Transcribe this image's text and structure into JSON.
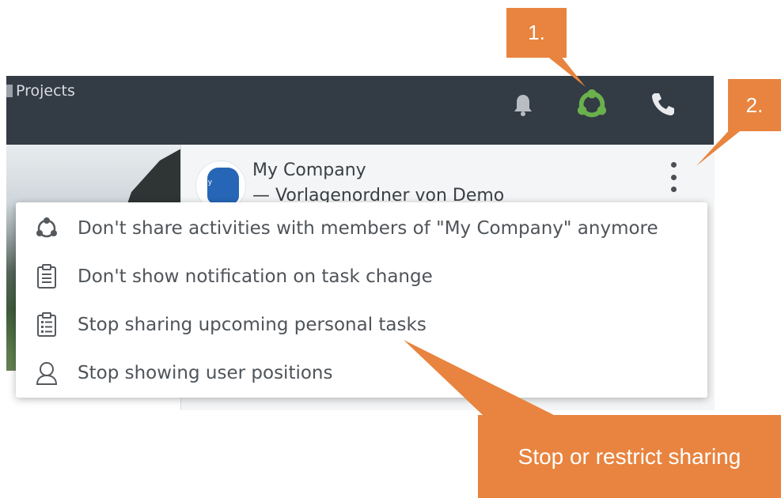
{
  "header": {
    "nav_label": "Projects",
    "icons": [
      "bell-icon",
      "share-activity-icon",
      "phone-icon"
    ]
  },
  "company": {
    "name": "My Company",
    "subtitle": "— Vorlagenordner von Demo",
    "logo_text": "my"
  },
  "menu": {
    "items": [
      {
        "icon": "share-circle-icon",
        "label": "Don't share activities with members of \"My Company\" anymore"
      },
      {
        "icon": "clipboard-icon",
        "label": "Don't show notification on task change"
      },
      {
        "icon": "task-list-icon",
        "label": "Stop sharing upcoming personal tasks"
      },
      {
        "icon": "user-position-icon",
        "label": "Stop showing user positions"
      }
    ]
  },
  "callouts": {
    "step1": "1.",
    "step2": "2.",
    "note": "Stop or restrict sharing"
  },
  "colors": {
    "topbar": "#333b45",
    "accent_orange": "#e8843f",
    "share_icon_green": "#6ab04c",
    "menu_text": "#4f5459"
  }
}
